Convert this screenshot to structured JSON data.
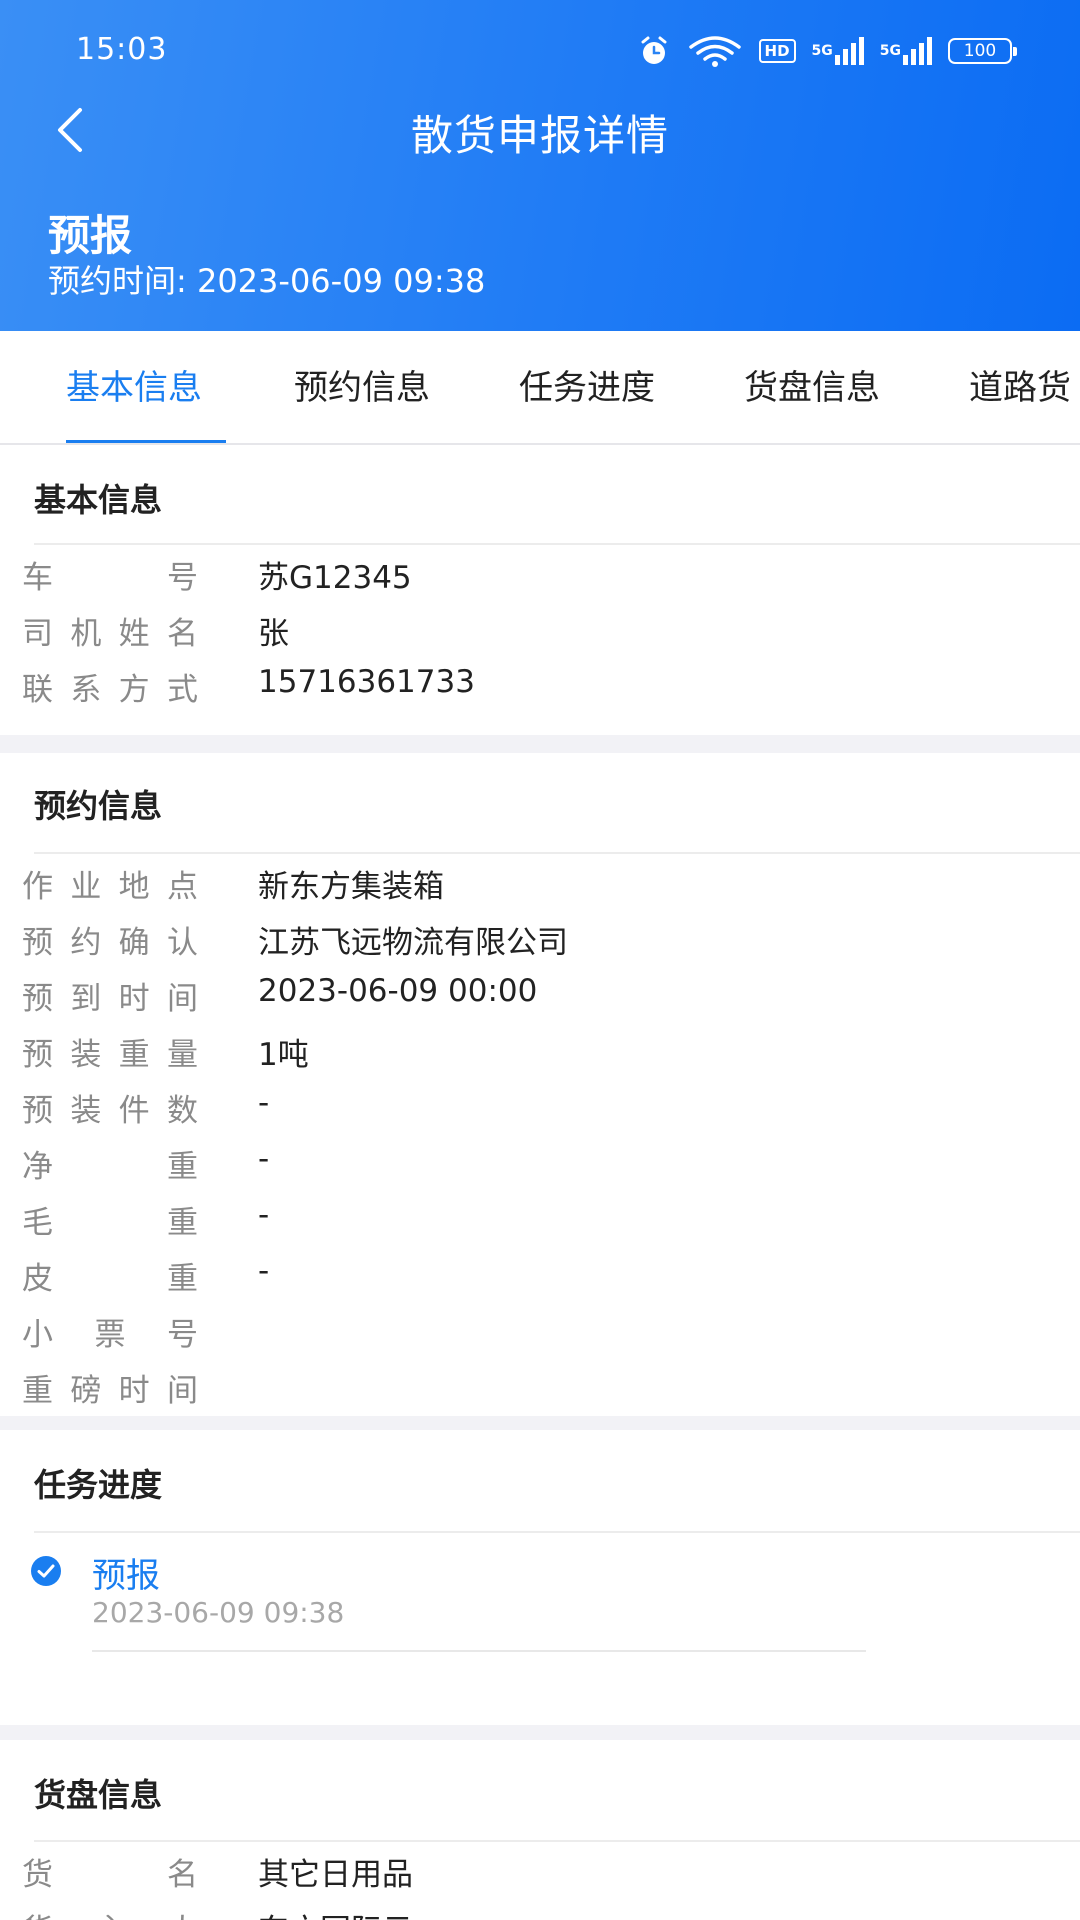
{
  "status_bar": {
    "time": "15:03",
    "battery": "100",
    "hd_label": "HD",
    "sig1": "5G",
    "sig2": "5G",
    "icons": [
      "alarm-icon",
      "wifi-icon",
      "hd-icon",
      "signal-5g-icon",
      "signal-5g-icon",
      "battery-icon"
    ]
  },
  "nav": {
    "title": "散货申报详情",
    "back_icon": "chevron-left-icon"
  },
  "header": {
    "status": "预报",
    "time_label": "预约时间: 2023-06-09 09:38"
  },
  "tabs": [
    "基本信息",
    "预约信息",
    "任务进度",
    "货盘信息",
    "道路货"
  ],
  "active_tab": 0,
  "basic": {
    "title": "基本信息",
    "rows": [
      {
        "label": "车号",
        "value": "苏G12345"
      },
      {
        "label": "司机姓名",
        "value": "张"
      },
      {
        "label": "联系方式",
        "value": "15716361733"
      }
    ]
  },
  "booking": {
    "title": "预约信息",
    "rows": [
      {
        "label": "作业地点",
        "value": "新东方集装箱"
      },
      {
        "label": "预约确认",
        "value": "江苏飞远物流有限公司"
      },
      {
        "label": "预到时间",
        "value": "2023-06-09 00:00"
      },
      {
        "label": "预装重量",
        "value": "1吨"
      },
      {
        "label": "预装件数",
        "value": "-"
      },
      {
        "label": "净重",
        "value": "-"
      },
      {
        "label": "毛重",
        "value": "-"
      },
      {
        "label": "皮重",
        "value": "-"
      },
      {
        "label": "小票号",
        "value": ""
      },
      {
        "label": "重磅时间",
        "value": ""
      }
    ]
  },
  "progress": {
    "title": "任务进度",
    "items": [
      {
        "name": "预报",
        "time": "2023-06-09 09:38",
        "done": true
      }
    ]
  },
  "cargo": {
    "title": "货盘信息",
    "rows": [
      {
        "label": "货名",
        "value": "其它日用品"
      },
      {
        "label": "货主人",
        "value": "东方国际云"
      }
    ]
  },
  "colors": {
    "accent": "#1a7ef0",
    "header_start": "#3a8ff5",
    "header_end": "#0b6cf3"
  }
}
